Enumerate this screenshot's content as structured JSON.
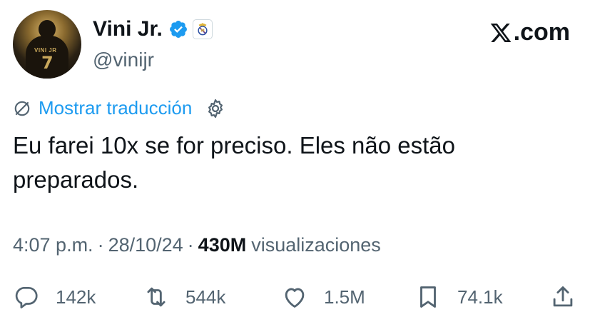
{
  "author": {
    "display_name": "Vini Jr.",
    "handle": "@vinijr",
    "verified_icon": "verified-badge-icon",
    "affiliation_icon": "real-madrid-crest-icon",
    "avatar_jersey_name": "VINI JR",
    "avatar_jersey_number": "7"
  },
  "brand": {
    "site": ".com",
    "logo_icon": "x-logo-icon"
  },
  "translation": {
    "label": "Mostrar traducción",
    "icon": "translate-icon",
    "settings_icon": "gear-icon"
  },
  "tweet": {
    "text": "Eu farei 10x se for preciso. Eles não estão preparados."
  },
  "meta": {
    "time": "4:07 p.m.",
    "separator": "·",
    "date": "28/10/24",
    "views_count": "430M",
    "views_label": "visualizaciones"
  },
  "actions": {
    "replies": "142k",
    "reposts": "544k",
    "likes": "1.5M",
    "bookmarks": "74.1k"
  },
  "colors": {
    "accent": "#1d9bf0",
    "text_primary": "#0f1419",
    "text_secondary": "#536471"
  }
}
